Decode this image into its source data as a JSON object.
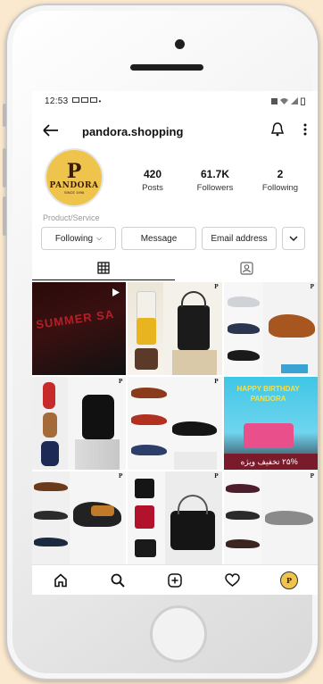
{
  "status": {
    "time": "12:53"
  },
  "header": {
    "username": "pandora.shopping"
  },
  "profile": {
    "logo_mark": "P",
    "logo_text": "PANDORA",
    "logo_sub": "SINCE 1998",
    "posts_count": "420",
    "posts_label": "Posts",
    "followers_count": "61.7K",
    "followers_label": "Followers",
    "following_count": "2",
    "following_label": "Following",
    "category": "Product/Service"
  },
  "buttons": {
    "following": "Following",
    "message": "Message",
    "email": "Email address"
  },
  "grid": {
    "post1_banner": "SUMMER SA",
    "post6_text": "HAPPY BIRTHDAY PANDORA",
    "post6_footer": "۲۵% تخفیف ویژه"
  },
  "icons": {
    "back": "back-arrow-icon",
    "bell": "bell-icon",
    "more": "more-vertical-icon",
    "grid": "grid-icon",
    "tagged": "tagged-person-icon",
    "home": "home-icon",
    "search": "search-icon",
    "add": "add-post-icon",
    "heart": "heart-icon",
    "reel": "play-icon"
  },
  "colors": {
    "brand_gold": "#efc44c",
    "brand_dark": "#3a1c0b",
    "background": "#fbe9cf"
  }
}
